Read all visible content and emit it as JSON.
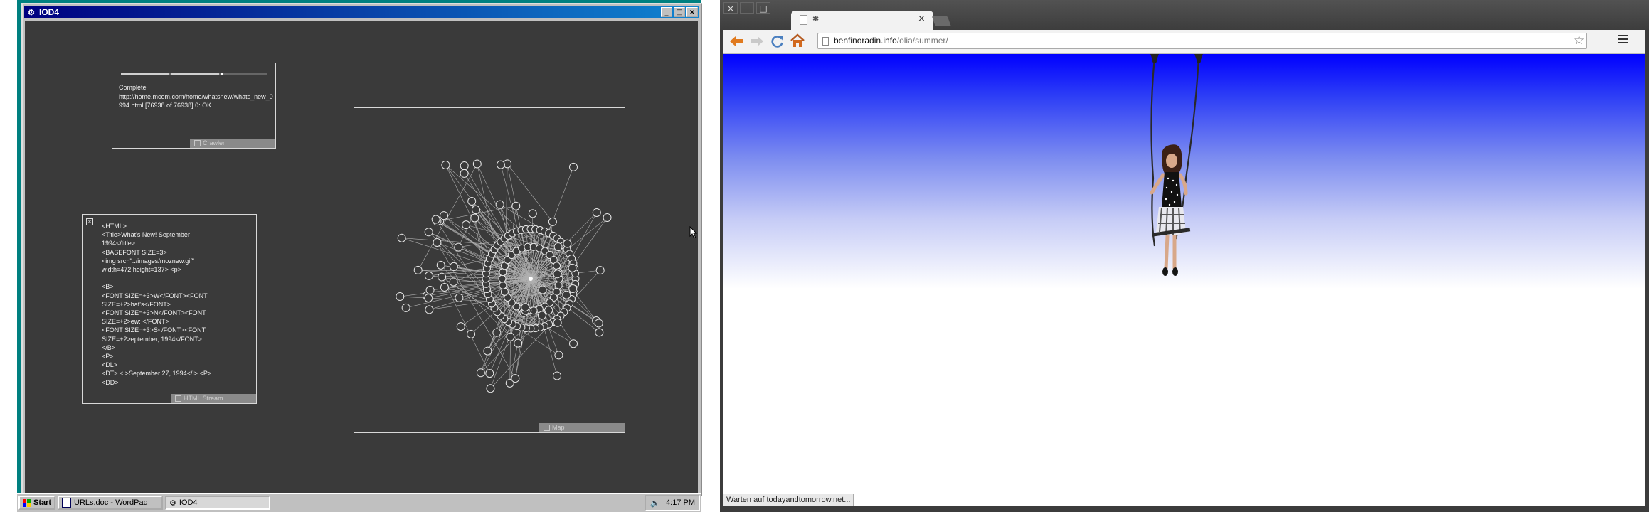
{
  "left_screen": {
    "window_title": "IOD4",
    "crawler_panel": {
      "status": "Complete",
      "url": "http://home.mcom.com/home/whatsnew/whats_new_0994.html [76938 of 76938] 0: OK",
      "label": "Crawler"
    },
    "html_stream_panel": {
      "close_glyph": "×",
      "source": "<HTML>\n<Title>What's New! September\n1994</title>\n<BASEFONT SIZE=3>\n<img src=\"../images/moznew.gif\"\nwidth=472 height=137> <p>\n\n<B>\n<FONT SIZE=+3>W</FONT><FONT\nSIZE=+2>hat's</FONT>\n<FONT SIZE=+3>N</FONT><FONT\nSIZE=+2>ew: </FONT>\n<FONT SIZE=+3>S</FONT><FONT\nSIZE=+2>eptember, 1994</FONT>\n</B>\n<P>\n<DL>\n<DT> <I>September 27, 1994</I> <P>\n<DD>",
      "label": "HTML Stream"
    },
    "map_panel": {
      "label": "Map"
    },
    "taskbar": {
      "start_label": "Start",
      "tasks": [
        {
          "label": "URLs.doc - WordPad",
          "icon": "wordpad-icon"
        },
        {
          "label": "IOD4",
          "icon": "iod4-app-icon"
        }
      ],
      "clock": "4:17 PM"
    }
  },
  "right_screen": {
    "browser": {
      "tab_title": "✱",
      "url_domain": "benfinoradin.info",
      "url_path": "/olia/summer/",
      "status_text": "Warten auf todayandtomorrow.net..."
    },
    "colors": {
      "sky_top": "#0000ff",
      "sky_bottom": "#ffffff"
    }
  }
}
